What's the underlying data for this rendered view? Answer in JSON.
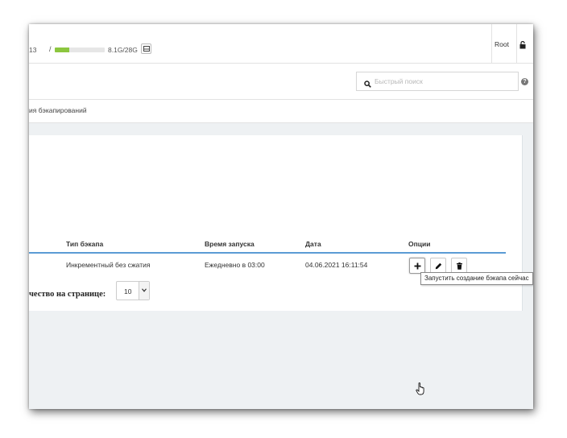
{
  "header": {
    "prev_text": "13",
    "disk_separator": "/",
    "disk_usage_text": "8.1G/28G",
    "disk_usage_fraction": 0.29,
    "disk_icon": "hdd-icon",
    "user_name": "Root",
    "lock_icon": "lock-icon"
  },
  "search": {
    "placeholder": "Быстрый поиск",
    "value": "",
    "icon": "search-icon",
    "help_icon": "question-circle-icon",
    "help_glyph": "?"
  },
  "breadcrumb": {
    "text": "ия бэкапирований"
  },
  "table": {
    "columns": [
      "Тип бэкапа",
      "Время запуска",
      "Дата",
      "Опции"
    ],
    "rows": [
      {
        "type": "Инкрементный без сжатия",
        "time": "Ежедневно в 03:00",
        "date": "04.06.2021 16:11:54"
      }
    ],
    "option_icons": [
      "plus-icon",
      "pencil-icon",
      "trash-icon"
    ]
  },
  "tooltip": {
    "text": "Запустить создание бэкапа сейчас"
  },
  "pagination": {
    "label": "чество на странице:",
    "per_page_value": "10"
  },
  "colors": {
    "accent": "#5b9bd5",
    "disk_fill": "#8cc63f",
    "content_bg": "#eef1f3"
  }
}
